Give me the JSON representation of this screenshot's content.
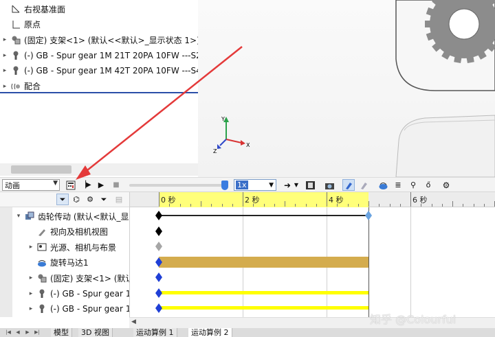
{
  "feature_tree": {
    "items": [
      {
        "label": "右视基准面",
        "icon": "plane-icon",
        "expandable": false
      },
      {
        "label": "原点",
        "icon": "origin-icon",
        "expandable": false
      },
      {
        "label": "(固定) 支架<1> (默认<<默认>_显示状态 1>)",
        "icon": "part-icon",
        "expandable": true
      },
      {
        "label": "(-) GB - Spur gear 1M 21T 20PA 10FW ---S2",
        "icon": "gear-part-icon",
        "expandable": true
      },
      {
        "label": "(-) GB - Spur gear 1M 42T 20PA 10FW ---S4",
        "icon": "gear-part-icon",
        "expandable": true
      },
      {
        "label": "配合",
        "icon": "mates-icon",
        "expandable": true
      }
    ]
  },
  "viewport": {
    "triad": {
      "x_axis": "X",
      "y_axis": "Y",
      "z_axis": "Z"
    }
  },
  "motion_toolbar": {
    "study_type": "动画",
    "playback_speed": "1x",
    "colors": {
      "slider": "#3a7de0",
      "accent": "#3b6fc8"
    }
  },
  "motion_tree": {
    "items": [
      {
        "label": "齿轮传动 (默认<默认_显",
        "icon": "assembly-icon",
        "expandable": true,
        "expanded": true
      },
      {
        "label": "视向及相机视图",
        "icon": "camera-icon",
        "expandable": false
      },
      {
        "label": "光源、相机与布景",
        "icon": "lights-icon",
        "expandable": true
      },
      {
        "label": "旋转马达1",
        "icon": "motor-icon",
        "expandable": false
      },
      {
        "label": "(固定) 支架<1> (默认",
        "icon": "part-icon",
        "expandable": true
      },
      {
        "label": "(-) GB - Spur gear 1",
        "icon": "gear-part-icon",
        "expandable": true
      },
      {
        "label": "(-) GB - Spur gear 1",
        "icon": "gear-part-icon",
        "expandable": true
      }
    ]
  },
  "timeline": {
    "seconds_per_major": 2,
    "ticks": [
      {
        "label": "0 秒",
        "seconds": 0
      },
      {
        "label": "2 秒",
        "seconds": 2
      },
      {
        "label": "4 秒",
        "seconds": 4
      },
      {
        "label": "6 秒",
        "seconds": 6
      }
    ],
    "duration_seconds": 5,
    "highlight_color": "#ffff7a",
    "rows": [
      {
        "keys": [
          {
            "t": 0,
            "color": "#000000"
          },
          {
            "t": 5,
            "color": "#6aa3e0"
          }
        ],
        "line": "black"
      },
      {
        "keys": [
          {
            "t": 0,
            "color": "#000000"
          }
        ],
        "line": "none"
      },
      {
        "keys": [
          {
            "t": 0,
            "color": "#a6a6a6"
          }
        ],
        "line": "none"
      },
      {
        "keys": [
          {
            "t": 0,
            "color": "#1f3fd6"
          }
        ],
        "line": "motor",
        "bar_color": "#d4ac4e"
      },
      {
        "keys": [
          {
            "t": 0,
            "color": "#1f3fd6"
          }
        ],
        "line": "none"
      },
      {
        "keys": [
          {
            "t": 0,
            "color": "#1f3fd6"
          }
        ],
        "line": "yellow",
        "bar_color": "#ffff00"
      },
      {
        "keys": [
          {
            "t": 0,
            "color": "#1f3fd6"
          }
        ],
        "line": "yellow",
        "bar_color": "#ffff00"
      }
    ]
  },
  "bottom_tabs": {
    "items": [
      {
        "label": "模型",
        "active": false
      },
      {
        "label": "3D 视图",
        "active": false
      },
      {
        "label": "运动算例 1",
        "active": false
      },
      {
        "label": "运动算例 2",
        "active": true
      }
    ]
  },
  "watermark": "知乎 @Colourful"
}
